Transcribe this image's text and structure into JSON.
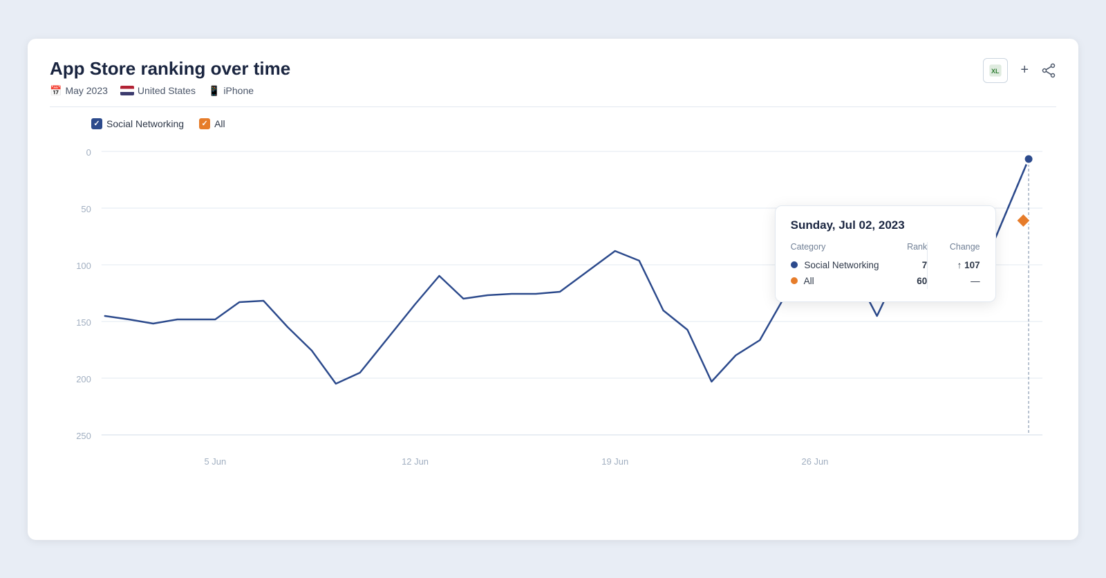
{
  "page": {
    "title": "App Store ranking over time",
    "meta": {
      "date": "May 2023",
      "country": "United States",
      "device": "iPhone"
    },
    "actions": {
      "excel_label": "XL",
      "add_label": "+",
      "share_label": "share"
    }
  },
  "legend": {
    "items": [
      {
        "id": "social-networking",
        "label": "Social Networking",
        "color": "blue"
      },
      {
        "id": "all",
        "label": "All",
        "color": "orange"
      }
    ]
  },
  "tooltip": {
    "date": "Sunday, Jul 02, 2023",
    "headers": [
      "Category",
      "Rank",
      "Change"
    ],
    "rows": [
      {
        "category": "Social Networking",
        "dot": "blue",
        "rank": "7",
        "change": "107",
        "change_type": "up"
      },
      {
        "category": "All",
        "dot": "orange",
        "rank": "60",
        "change": "—",
        "change_type": "dash"
      }
    ]
  },
  "chart": {
    "y_labels": [
      "0",
      "50",
      "100",
      "150",
      "200",
      "250"
    ],
    "x_labels": [
      "5 Jun",
      "12 Jun",
      "19 Jun",
      "26 Jun"
    ]
  }
}
